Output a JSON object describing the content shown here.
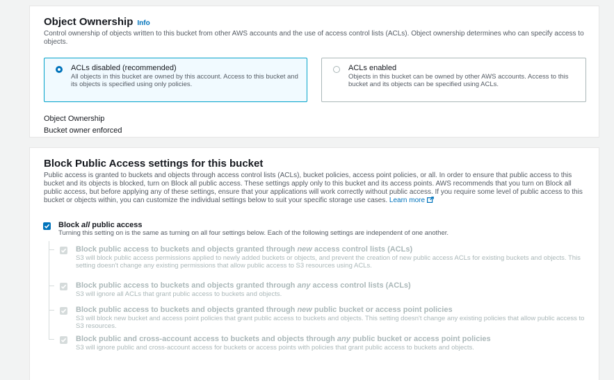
{
  "ownership": {
    "title": "Object Ownership",
    "info": "Info",
    "description": "Control ownership of objects written to this bucket from other AWS accounts and the use of access control lists (ACLs). Object ownership determines who can specify access to objects.",
    "options": [
      {
        "title": "ACLs disabled (recommended)",
        "description": "All objects in this bucket are owned by this account. Access to this bucket and its objects is specified using only policies.",
        "selected": true
      },
      {
        "title": "ACLs enabled",
        "description": "Objects in this bucket can be owned by other AWS accounts. Access to this bucket and its objects can be specified using ACLs.",
        "selected": false
      }
    ],
    "field_label": "Object Ownership",
    "field_value": "Bucket owner enforced"
  },
  "block": {
    "title": "Block Public Access settings for this bucket",
    "description": "Public access is granted to buckets and objects through access control lists (ACLs), bucket policies, access point policies, or all. In order to ensure that public access to this bucket and its objects is blocked, turn on Block all public access. These settings apply only to this bucket and its access points. AWS recommends that you turn on Block all public access, but before applying any of these settings, ensure that your applications will work correctly without public access. If you require some level of public access to this bucket or objects within, you can customize the individual settings below to suit your specific storage use cases.",
    "learn_more": "Learn more",
    "all": {
      "prefix": "Block ",
      "emphasis": "all",
      "suffix": " public access",
      "description": "Turning this setting on is the same as turning on all four settings below. Each of the following settings are independent of one another.",
      "checked": true
    },
    "settings": [
      {
        "prefix": "Block public access to buckets and objects granted through ",
        "emphasis": "new",
        "suffix": " access control lists (ACLs)",
        "description": "S3 will block public access permissions applied to newly added buckets or objects, and prevent the creation of new public access ACLs for existing buckets and objects. This setting doesn't change any existing permissions that allow public access to S3 resources using ACLs."
      },
      {
        "prefix": "Block public access to buckets and objects granted through ",
        "emphasis": "any",
        "suffix": " access control lists (ACLs)",
        "description": "S3 will ignore all ACLs that grant public access to buckets and objects."
      },
      {
        "prefix": "Block public access to buckets and objects granted through ",
        "emphasis": "new",
        "suffix": " public bucket or access point policies",
        "description": "S3 will block new bucket and access point policies that grant public access to buckets and objects. This setting doesn't change any existing policies that allow public access to S3 resources."
      },
      {
        "prefix": "Block public and cross-account access to buckets and objects through ",
        "emphasis": "any",
        "suffix": " public bucket or access point policies",
        "description": "S3 will ignore public and cross-account access for buckets or access points with policies that grant public access to buckets and objects."
      }
    ]
  },
  "colors": {
    "accent": "#0073bb",
    "selected_border": "#00a1c9",
    "selected_bg": "#f1faff",
    "disabled_text": "#aab7b8"
  }
}
